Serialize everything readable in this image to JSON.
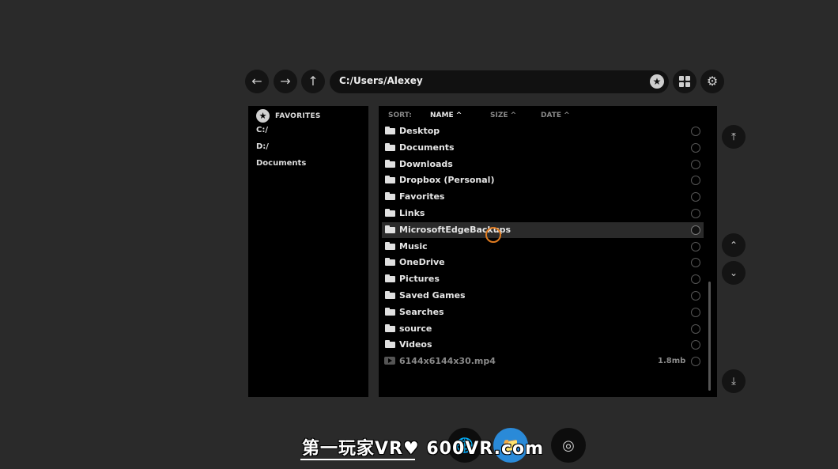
{
  "toolbar": {
    "back_icon": "arrow-left-icon",
    "forward_icon": "arrow-right-icon",
    "up_icon": "arrow-up-icon",
    "path": "C:/Users/Alexey",
    "grid_icon": "grid-view-icon",
    "settings_icon": "gear-icon"
  },
  "sidebar": {
    "favorites_label": "FAVORITES",
    "items": [
      {
        "label": "C:/"
      },
      {
        "label": "D:/"
      },
      {
        "label": "Documents"
      }
    ]
  },
  "sort": {
    "label": "SORT:",
    "name": "NAME ^",
    "size": "SIZE ^",
    "date": "DATE ^"
  },
  "files": [
    {
      "name": "Desktop",
      "type": "folder"
    },
    {
      "name": "Documents",
      "type": "folder"
    },
    {
      "name": "Downloads",
      "type": "folder"
    },
    {
      "name": "Dropbox (Personal)",
      "type": "folder"
    },
    {
      "name": "Favorites",
      "type": "folder"
    },
    {
      "name": "Links",
      "type": "folder"
    },
    {
      "name": "MicrosoftEdgeBackups",
      "type": "folder",
      "selected": true
    },
    {
      "name": "Music",
      "type": "folder"
    },
    {
      "name": "OneDrive",
      "type": "folder"
    },
    {
      "name": "Pictures",
      "type": "folder"
    },
    {
      "name": "Saved Games",
      "type": "folder"
    },
    {
      "name": "Searches",
      "type": "folder"
    },
    {
      "name": "source",
      "type": "folder"
    },
    {
      "name": "Videos",
      "type": "folder"
    },
    {
      "name": "6144x6144x30.mp4",
      "type": "video",
      "size": "1.8mb"
    }
  ],
  "watermark": {
    "text": "第一玩家VR♥ 600VR.com"
  },
  "colors": {
    "accent": "#2a8ad8",
    "cursor": "#e07b20"
  }
}
